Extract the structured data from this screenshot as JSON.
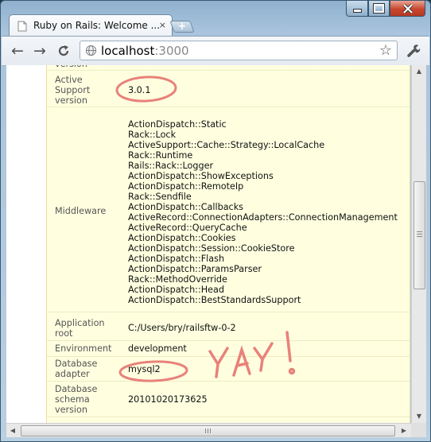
{
  "tab": {
    "title": "Ruby on Rails: Welcome ...",
    "close_glyph": "×",
    "new_tab_glyph": "+"
  },
  "toolbar": {
    "back_glyph": "←",
    "forward_glyph": "→",
    "url_host": "localhost",
    "url_port": ":3000",
    "star_glyph": "☆"
  },
  "env_table": {
    "top_cut_label": "version",
    "rows": [
      {
        "label": "Active Support version",
        "value": "3.0.1"
      },
      {
        "label": "Middleware",
        "values": [
          "ActionDispatch::Static",
          "Rack::Lock",
          "ActiveSupport::Cache::Strategy::LocalCache",
          "Rack::Runtime",
          "Rails::Rack::Logger",
          "ActionDispatch::ShowExceptions",
          "ActionDispatch::RemoteIp",
          "Rack::Sendfile",
          "ActionDispatch::Callbacks",
          "ActiveRecord::ConnectionAdapters::ConnectionManagement",
          "ActiveRecord::QueryCache",
          "ActionDispatch::Cookies",
          "ActionDispatch::Session::CookieStore",
          "ActionDispatch::Flash",
          "ActionDispatch::ParamsParser",
          "Rack::MethodOverride",
          "ActionDispatch::Head",
          "ActionDispatch::BestStandardsSupport"
        ]
      },
      {
        "label": "Application root",
        "value": "C:/Users/bry/railsftw-0-2"
      },
      {
        "label": "Environment",
        "value": "development"
      },
      {
        "label": "Database adapter",
        "value": "mysql2"
      },
      {
        "label": "Database schema version",
        "value": "20101020173625"
      }
    ]
  },
  "annotation": {
    "text": "YAY!",
    "color": "#e8827a"
  },
  "colors": {
    "panel_bg": "#ffffe0",
    "window_frame": "#8fb1cf",
    "close_button": "#c9462e"
  }
}
